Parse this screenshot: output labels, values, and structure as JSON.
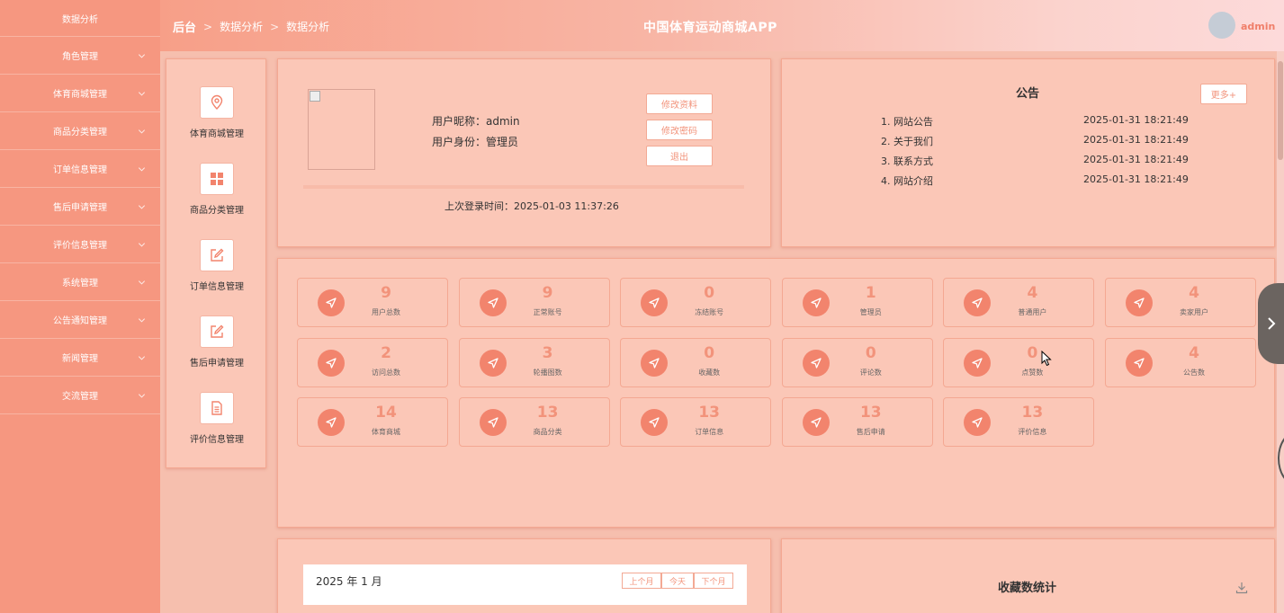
{
  "sidebar": {
    "items": [
      {
        "label": "数据分析",
        "has_chevron": false
      },
      {
        "label": "角色管理",
        "has_chevron": true
      },
      {
        "label": "体育商城管理",
        "has_chevron": true
      },
      {
        "label": "商品分类管理",
        "has_chevron": true
      },
      {
        "label": "订单信息管理",
        "has_chevron": true
      },
      {
        "label": "售后申请管理",
        "has_chevron": true
      },
      {
        "label": "评价信息管理",
        "has_chevron": true
      },
      {
        "label": "系统管理",
        "has_chevron": true
      },
      {
        "label": "公告通知管理",
        "has_chevron": true
      },
      {
        "label": "新闻管理",
        "has_chevron": true
      },
      {
        "label": "交流管理",
        "has_chevron": true
      }
    ]
  },
  "header": {
    "breadcrumb": [
      "后台",
      "数据分析",
      "数据分析"
    ],
    "separator": ">",
    "app_title": "中国体育运动商城APP",
    "username": "admin"
  },
  "shortcuts": [
    {
      "label": "体育商城管理",
      "icon": "location-pin-icon"
    },
    {
      "label": "商品分类管理",
      "icon": "grid-icon"
    },
    {
      "label": "订单信息管理",
      "icon": "edit-icon"
    },
    {
      "label": "售后申请管理",
      "icon": "edit-icon"
    },
    {
      "label": "评价信息管理",
      "icon": "document-icon"
    }
  ],
  "user": {
    "nickname_line": "用户昵称：admin",
    "role_line": "用户身份：管理员",
    "buttons": {
      "edit_profile": "修改资料",
      "change_password": "修改密码",
      "logout": "退出"
    },
    "last_login": "上次登录时间：2025-01-03 11:37:26"
  },
  "notice": {
    "title": "公告",
    "more_label": "更多+",
    "items": [
      {
        "title": "1. 网站公告",
        "date": "2025-01-31 18:21:49"
      },
      {
        "title": "2. 关于我们",
        "date": "2025-01-31 18:21:49"
      },
      {
        "title": "3. 联系方式",
        "date": "2025-01-31 18:21:49"
      },
      {
        "title": "4. 网站介绍",
        "date": "2025-01-31 18:21:49"
      }
    ]
  },
  "stats": [
    {
      "value": "9",
      "label": "用户总数"
    },
    {
      "value": "9",
      "label": "正常账号"
    },
    {
      "value": "0",
      "label": "冻结账号"
    },
    {
      "value": "1",
      "label": "管理员"
    },
    {
      "value": "4",
      "label": "普通用户"
    },
    {
      "value": "4",
      "label": "卖家用户"
    },
    {
      "value": "2",
      "label": "访问总数"
    },
    {
      "value": "3",
      "label": "轮播图数"
    },
    {
      "value": "0",
      "label": "收藏数"
    },
    {
      "value": "0",
      "label": "评论数"
    },
    {
      "value": "0",
      "label": "点赞数"
    },
    {
      "value": "4",
      "label": "公告数"
    },
    {
      "value": "14",
      "label": "体育商城"
    },
    {
      "value": "13",
      "label": "商品分类"
    },
    {
      "value": "13",
      "label": "订单信息"
    },
    {
      "value": "13",
      "label": "售后申请"
    },
    {
      "value": "13",
      "label": "评价信息"
    }
  ],
  "calendar": {
    "title": "2025 年 1 月",
    "prev_label": "上个月",
    "today_label": "今天",
    "next_label": "下个月"
  },
  "favorites_chart": {
    "title": "收藏数统计"
  },
  "colors": {
    "sidebar": "#f69780",
    "accent": "#f2937b",
    "panel": "#fbc7b7",
    "circle": "#f2846d"
  }
}
